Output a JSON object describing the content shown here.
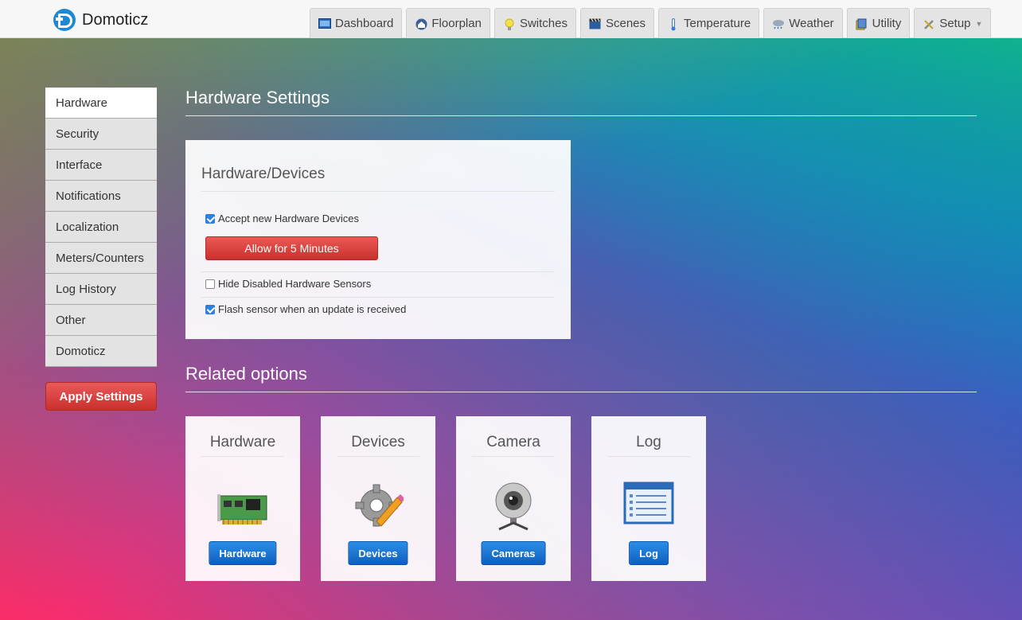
{
  "app": {
    "name": "Domoticz"
  },
  "nav": {
    "items": [
      {
        "label": "Dashboard",
        "icon": "dashboard-icon"
      },
      {
        "label": "Floorplan",
        "icon": "floorplan-icon"
      },
      {
        "label": "Switches",
        "icon": "lightbulb-icon"
      },
      {
        "label": "Scenes",
        "icon": "clapperboard-icon"
      },
      {
        "label": "Temperature",
        "icon": "thermometer-icon"
      },
      {
        "label": "Weather",
        "icon": "rain-cloud-icon"
      },
      {
        "label": "Utility",
        "icon": "utility-icon"
      },
      {
        "label": "Setup",
        "icon": "tools-icon"
      }
    ]
  },
  "sidebar": {
    "items": [
      {
        "label": "Hardware",
        "active": true
      },
      {
        "label": "Security"
      },
      {
        "label": "Interface"
      },
      {
        "label": "Notifications"
      },
      {
        "label": "Localization"
      },
      {
        "label": "Meters/Counters"
      },
      {
        "label": "Log History"
      },
      {
        "label": "Other"
      },
      {
        "label": "Domoticz"
      }
    ],
    "apply_label": "Apply Settings"
  },
  "main": {
    "title": "Hardware Settings",
    "panel": {
      "title": "Hardware/Devices",
      "accept_new": {
        "label": "Accept new Hardware Devices",
        "checked": true
      },
      "allow_button": "Allow for 5 Minutes",
      "hide_disabled": {
        "label": "Hide Disabled Hardware Sensors",
        "checked": false
      },
      "flash_sensor": {
        "label": "Flash sensor when an update is received",
        "checked": true
      }
    },
    "related_title": "Related options",
    "cards": [
      {
        "title": "Hardware",
        "button": "Hardware",
        "icon": "hardware-card-icon"
      },
      {
        "title": "Devices",
        "button": "Devices",
        "icon": "gear-pencil-icon"
      },
      {
        "title": "Camera",
        "button": "Cameras",
        "icon": "webcam-icon"
      },
      {
        "title": "Log",
        "button": "Log",
        "icon": "log-list-icon"
      }
    ]
  },
  "colors": {
    "danger": "#c9302c",
    "primary": "#0f5fbf",
    "checkbox": "#2f7fdc"
  }
}
